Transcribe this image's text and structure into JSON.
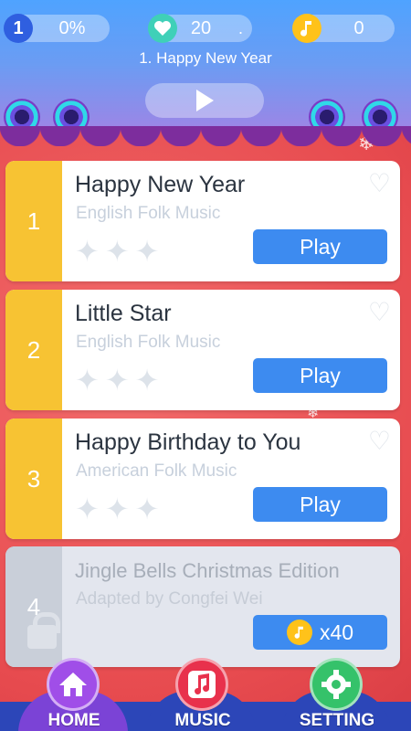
{
  "header": {
    "level": {
      "number": "1",
      "progress": "0%"
    },
    "lives": {
      "count": "20",
      "suffix": "."
    },
    "coins": {
      "count": "0"
    },
    "song_title": "1. Happy New Year"
  },
  "songs": [
    {
      "number": "1",
      "title": "Happy New Year",
      "subtitle": "English Folk Music",
      "stars": 0,
      "button": "Play"
    },
    {
      "number": "2",
      "title": "Little Star",
      "subtitle": "English Folk Music",
      "stars": 0,
      "button": "Play"
    },
    {
      "number": "3",
      "title": "Happy Birthday to You",
      "subtitle": "American Folk Music",
      "stars": 0,
      "button": "Play"
    },
    {
      "number": "4",
      "title": "Jingle Bells Christmas Edition",
      "subtitle": "Adapted by Congfei Wei",
      "price": "x40",
      "locked": true
    }
  ],
  "nav": {
    "home": "HOME",
    "music": "MUSIC",
    "setting": "SETTING"
  },
  "colors": {
    "accent_blue": "#3d8bf0",
    "number_yellow": "#f7c333",
    "background_red": "#e74b4f",
    "coin_gold": "#ffc21a"
  }
}
